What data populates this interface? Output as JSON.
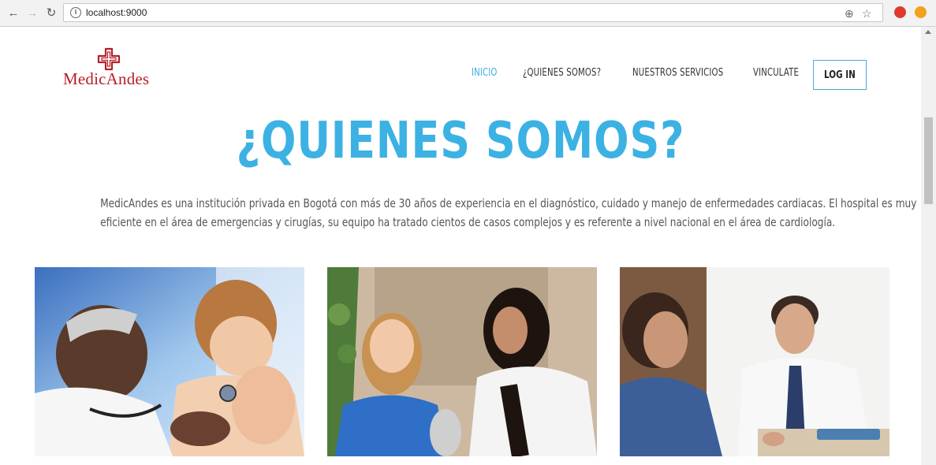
{
  "browser": {
    "url": "localhost:9000",
    "back_icon": "arrow-left-icon",
    "forward_icon": "arrow-right-icon",
    "reload_icon": "reload-icon"
  },
  "brand": {
    "name": "MedicAndes",
    "color": "#b5202a"
  },
  "nav": {
    "items": [
      {
        "label": "INICIO",
        "active": true
      },
      {
        "label": "¿QUIENES SOMOS?",
        "active": false
      },
      {
        "label": "NUESTROS SERVICIOS",
        "active": false
      },
      {
        "label": "VINCULATE",
        "active": false
      }
    ],
    "login_label": "LOG IN",
    "accent": "#3aaee0"
  },
  "main": {
    "title": "¿QUIENES SOMOS?",
    "description_line1": "MedicAndes es una institución privada en Bogotá con más de 30 años de experiencia en el diagnóstico, cuidado y manejo de enfermedades cardiacas. El hospital es muy",
    "description_line2": "eficiente en el área de emergencias y cirugías, su equipo ha tratado cientos de casos complejos y es referente a nivel nacional en el área de cardiología."
  }
}
